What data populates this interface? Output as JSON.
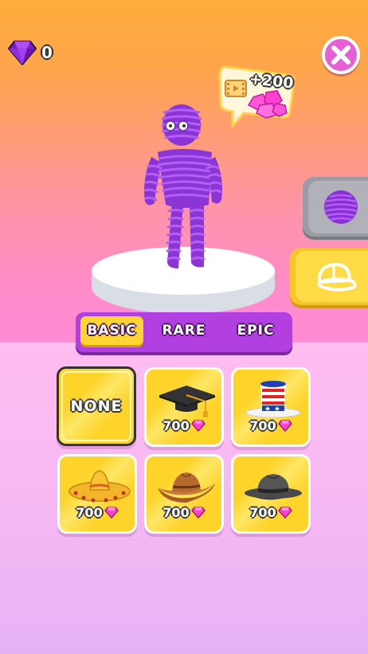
{
  "currency": {
    "gems": "0",
    "icon": "gem-icon"
  },
  "reward": {
    "label": "+200",
    "icon": "video-ad-icon"
  },
  "tabs": [
    {
      "label": "BASIC",
      "active": true
    },
    {
      "label": "RARE",
      "active": false
    },
    {
      "label": "EPIC",
      "active": false
    }
  ],
  "items": [
    {
      "name": "none",
      "label": "NONE",
      "selected": true
    },
    {
      "name": "graduation-cap",
      "price": "700",
      "icon": "graduation-cap-icon"
    },
    {
      "name": "uncle-sam-hat",
      "price": "700",
      "icon": "uncle-sam-hat-icon"
    },
    {
      "name": "sombrero",
      "price": "700",
      "icon": "sombrero-icon"
    },
    {
      "name": "cowboy-hat",
      "price": "700",
      "icon": "cowboy-hat-icon"
    },
    {
      "name": "fedora",
      "price": "700",
      "icon": "fedora-icon"
    }
  ],
  "colors": {
    "accent_purple": "#b23fe0",
    "card_yellow": "#ffd42a",
    "gem_pink": "#ff3fd0",
    "character_purple": "#9a3ee0"
  }
}
